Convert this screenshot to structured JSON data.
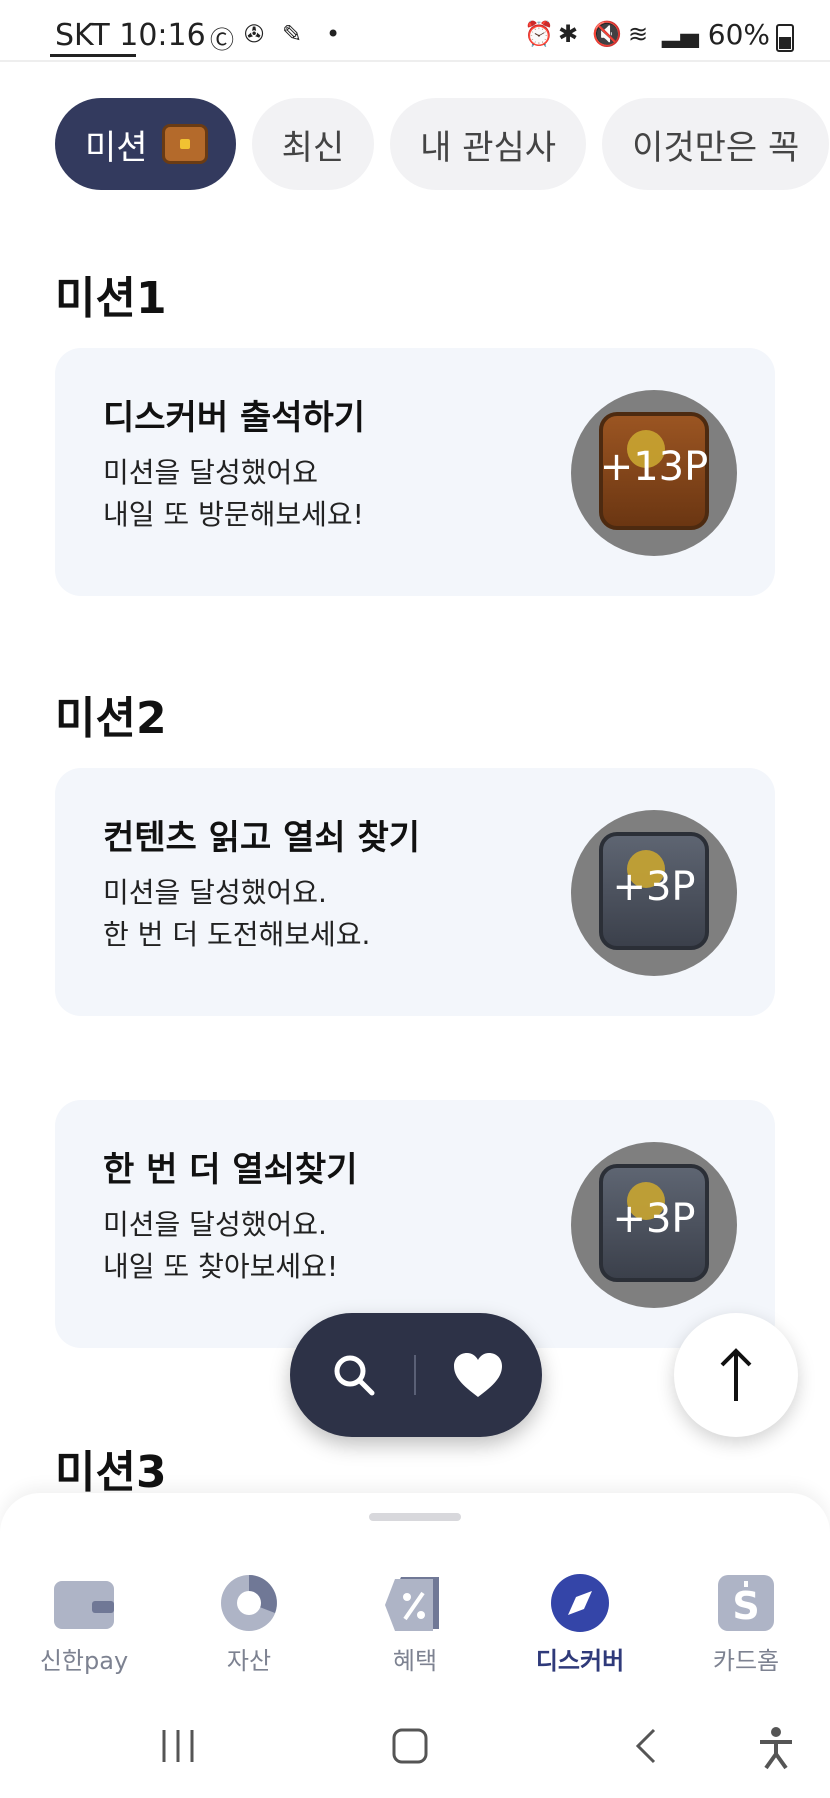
{
  "status_bar": {
    "carrier_time": "SKT 10:16",
    "battery": "60%"
  },
  "tabs": [
    {
      "label": "미션",
      "active": true
    },
    {
      "label": "최신",
      "active": false
    },
    {
      "label": "내 관심사",
      "active": false
    },
    {
      "label": "이것만은 꼭",
      "active": false
    }
  ],
  "sections": {
    "s1": "미션1",
    "s2": "미션2",
    "s3": "미션3"
  },
  "cards": [
    {
      "title": "디스커버 출석하기",
      "desc": "미션을 달성했어요\n내일 또 방문해보세요!",
      "reward": "+13P",
      "chest": "brown"
    },
    {
      "title": "컨텐츠 읽고 열쇠 찾기",
      "desc": "미션을 달성했어요.\n한 번 더 도전해보세요.",
      "reward": "+3P",
      "chest": "gray"
    },
    {
      "title": "한 번 더 열쇠찾기",
      "desc": "미션을 달성했어요.\n내일 또 찾아보세요!",
      "reward": "+3P",
      "chest": "gray"
    }
  ],
  "bottom_nav": [
    {
      "label": "신한pay",
      "icon": "wallet-icon"
    },
    {
      "label": "자산",
      "icon": "pie-chart-icon"
    },
    {
      "label": "혜택",
      "icon": "discount-tag-icon"
    },
    {
      "label": "디스커버",
      "icon": "compass-icon",
      "active": true
    },
    {
      "label": "카드홈",
      "icon": "card-home-icon"
    }
  ],
  "colors": {
    "primary_dark": "#333a5e",
    "fab_bg": "#2d3247",
    "card_bg": "#f3f6fb",
    "nav_active": "#2f3a7a"
  }
}
